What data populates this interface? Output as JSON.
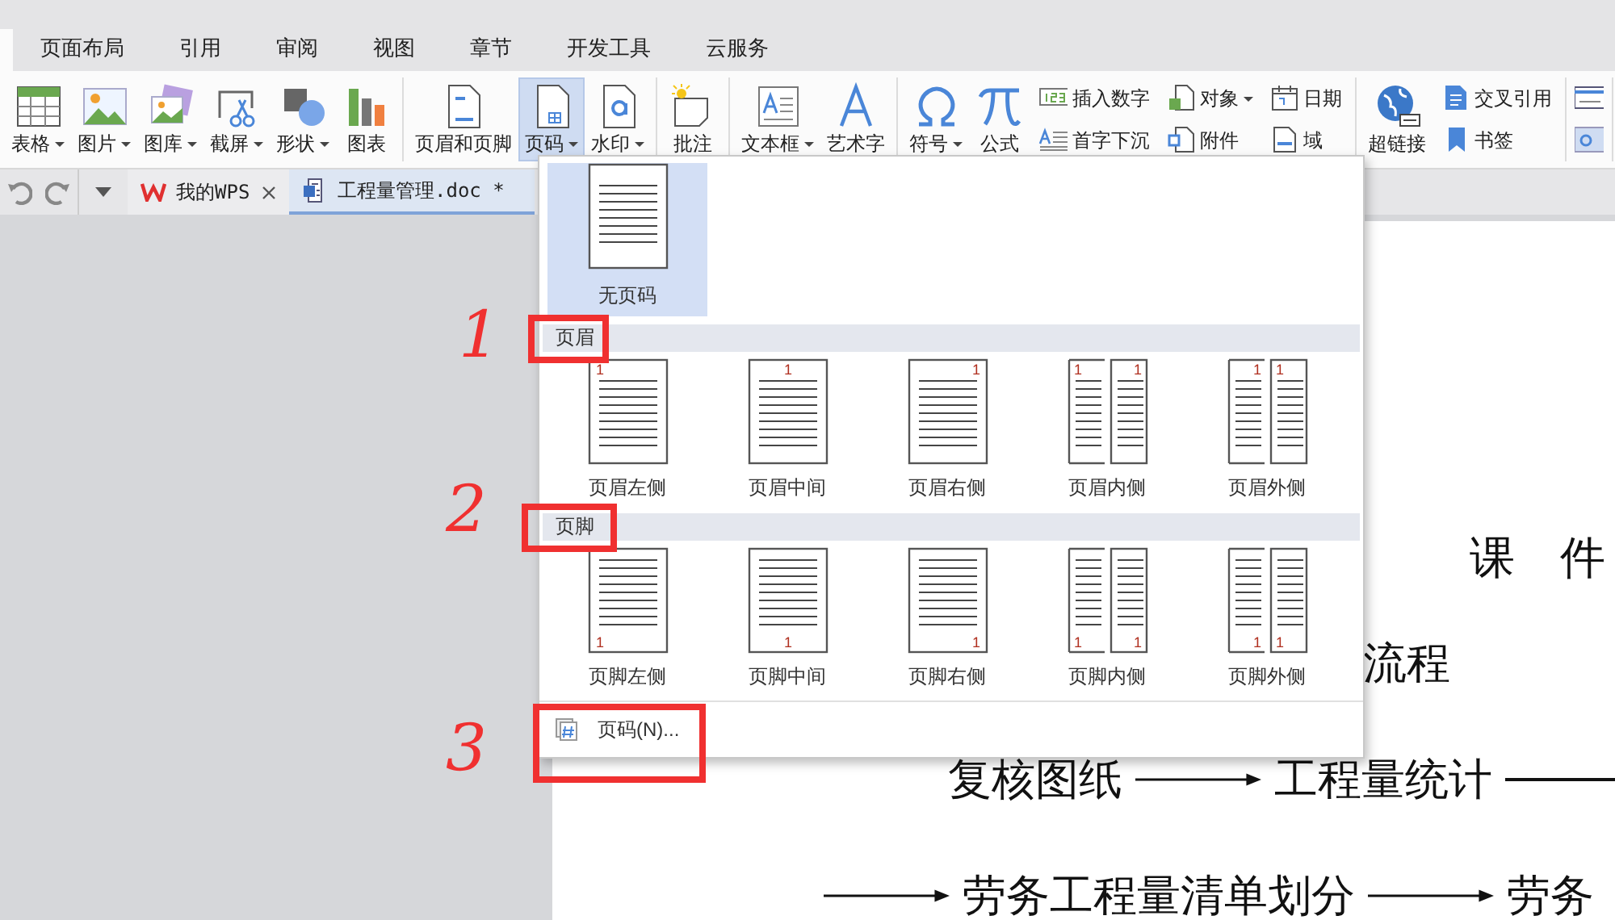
{
  "menu_tabs": [
    {
      "label": "页面布局",
      "selected": false
    },
    {
      "label": "引用",
      "selected": false
    },
    {
      "label": "审阅",
      "selected": false
    },
    {
      "label": "视图",
      "selected": false
    },
    {
      "label": "章节",
      "selected": false
    },
    {
      "label": "开发工具",
      "selected": false
    },
    {
      "label": "云服务",
      "selected": false
    }
  ],
  "ribbon": {
    "groups": [
      {
        "columns": [
          {
            "kind": "large",
            "label": "表格",
            "dropdown": true,
            "open": false
          },
          {
            "kind": "large",
            "label": "图片",
            "dropdown": true,
            "open": false
          },
          {
            "kind": "large",
            "label": "图库",
            "dropdown": true,
            "open": false
          },
          {
            "kind": "large",
            "label": "截屏",
            "dropdown": true,
            "open": false
          },
          {
            "kind": "large",
            "label": "形状",
            "dropdown": true,
            "open": false
          },
          {
            "kind": "large",
            "label": "图表",
            "dropdown": false,
            "open": false
          }
        ]
      },
      {
        "columns": [
          {
            "kind": "large",
            "label": "页眉和页脚",
            "dropdown": false,
            "open": false
          },
          {
            "kind": "large",
            "label": "页码",
            "dropdown": true,
            "open": true
          },
          {
            "kind": "large",
            "label": "水印",
            "dropdown": true,
            "open": false
          }
        ]
      },
      {
        "columns": [
          {
            "kind": "large",
            "label": "批注",
            "dropdown": false,
            "open": false
          }
        ]
      },
      {
        "columns": [
          {
            "kind": "large",
            "label": "文本框",
            "dropdown": true,
            "open": false
          },
          {
            "kind": "large",
            "label": "艺术字",
            "dropdown": false,
            "open": false
          }
        ]
      },
      {
        "columns": [
          {
            "kind": "large",
            "label": "符号",
            "dropdown": true,
            "open": false
          },
          {
            "kind": "large",
            "label": "公式",
            "dropdown": false,
            "open": false
          },
          {
            "kind": "stack",
            "open": false,
            "items": [
              {
                "label": "插入数字",
                "dropdown": false
              },
              {
                "label": "首字下沉",
                "dropdown": false
              }
            ]
          },
          {
            "kind": "stack",
            "open": false,
            "items": [
              {
                "label": "对象",
                "dropdown": true
              },
              {
                "label": "附件",
                "dropdown": false
              }
            ]
          },
          {
            "kind": "stack",
            "open": false,
            "items": [
              {
                "label": "日期",
                "dropdown": false
              },
              {
                "label": "域",
                "dropdown": false
              }
            ]
          }
        ]
      },
      {
        "columns": [
          {
            "kind": "large",
            "label": "超链接",
            "dropdown": false,
            "open": false
          },
          {
            "kind": "stack",
            "open": false,
            "items": [
              {
                "label": "交叉引用",
                "dropdown": false
              },
              {
                "label": "书签",
                "dropdown": false
              }
            ]
          }
        ]
      }
    ]
  },
  "doc_tabs": [
    {
      "label": "我的WPS",
      "closable": true,
      "selected": false
    },
    {
      "label": "工程量管理.doc *",
      "closable": false,
      "selected": true
    }
  ],
  "document": {
    "title": "课　件",
    "lines": [
      {
        "segments": [
          {
            "kind": "text",
            "text": "流程"
          }
        ]
      },
      {
        "segments": [
          {
            "kind": "text",
            "text": "复核图纸"
          },
          {
            "kind": "arrow"
          },
          {
            "kind": "text",
            "text": "工程量统计"
          },
          {
            "kind": "line"
          }
        ]
      },
      {
        "segments": [
          {
            "kind": "arrow"
          },
          {
            "kind": "text",
            "text": "劳务工程量清单划分"
          },
          {
            "kind": "arrow"
          },
          {
            "kind": "text",
            "text": "劳务"
          }
        ]
      }
    ]
  },
  "page_number_menu": {
    "no_number": {
      "label": "无页码",
      "selected": true
    },
    "sections": [
      {
        "title": "页眉",
        "options": [
          {
            "label": "页眉左侧",
            "numbers": [
              "1"
            ],
            "selected": false
          },
          {
            "label": "页眉中间",
            "numbers": [
              "1"
            ],
            "selected": false
          },
          {
            "label": "页眉右侧",
            "numbers": [
              "1"
            ],
            "selected": false
          },
          {
            "label": "页眉内侧",
            "numbers": [
              "1",
              "1"
            ],
            "selected": false
          },
          {
            "label": "页眉外侧",
            "numbers": [
              "1",
              "1"
            ],
            "selected": false
          }
        ]
      },
      {
        "title": "页脚",
        "options": [
          {
            "label": "页脚左侧",
            "numbers": [
              "1"
            ],
            "selected": false
          },
          {
            "label": "页脚中间",
            "numbers": [
              "1"
            ],
            "selected": false
          },
          {
            "label": "页脚右侧",
            "numbers": [
              "1"
            ],
            "selected": false
          },
          {
            "label": "页脚内侧",
            "numbers": [
              "1",
              "1"
            ],
            "selected": false
          },
          {
            "label": "页脚外侧",
            "numbers": [
              "1",
              "1"
            ],
            "selected": false
          }
        ]
      }
    ],
    "command": {
      "label": "页码(N)..."
    }
  },
  "annotations": [
    {
      "number": "1"
    },
    {
      "number": "2"
    },
    {
      "number": "3"
    }
  ]
}
